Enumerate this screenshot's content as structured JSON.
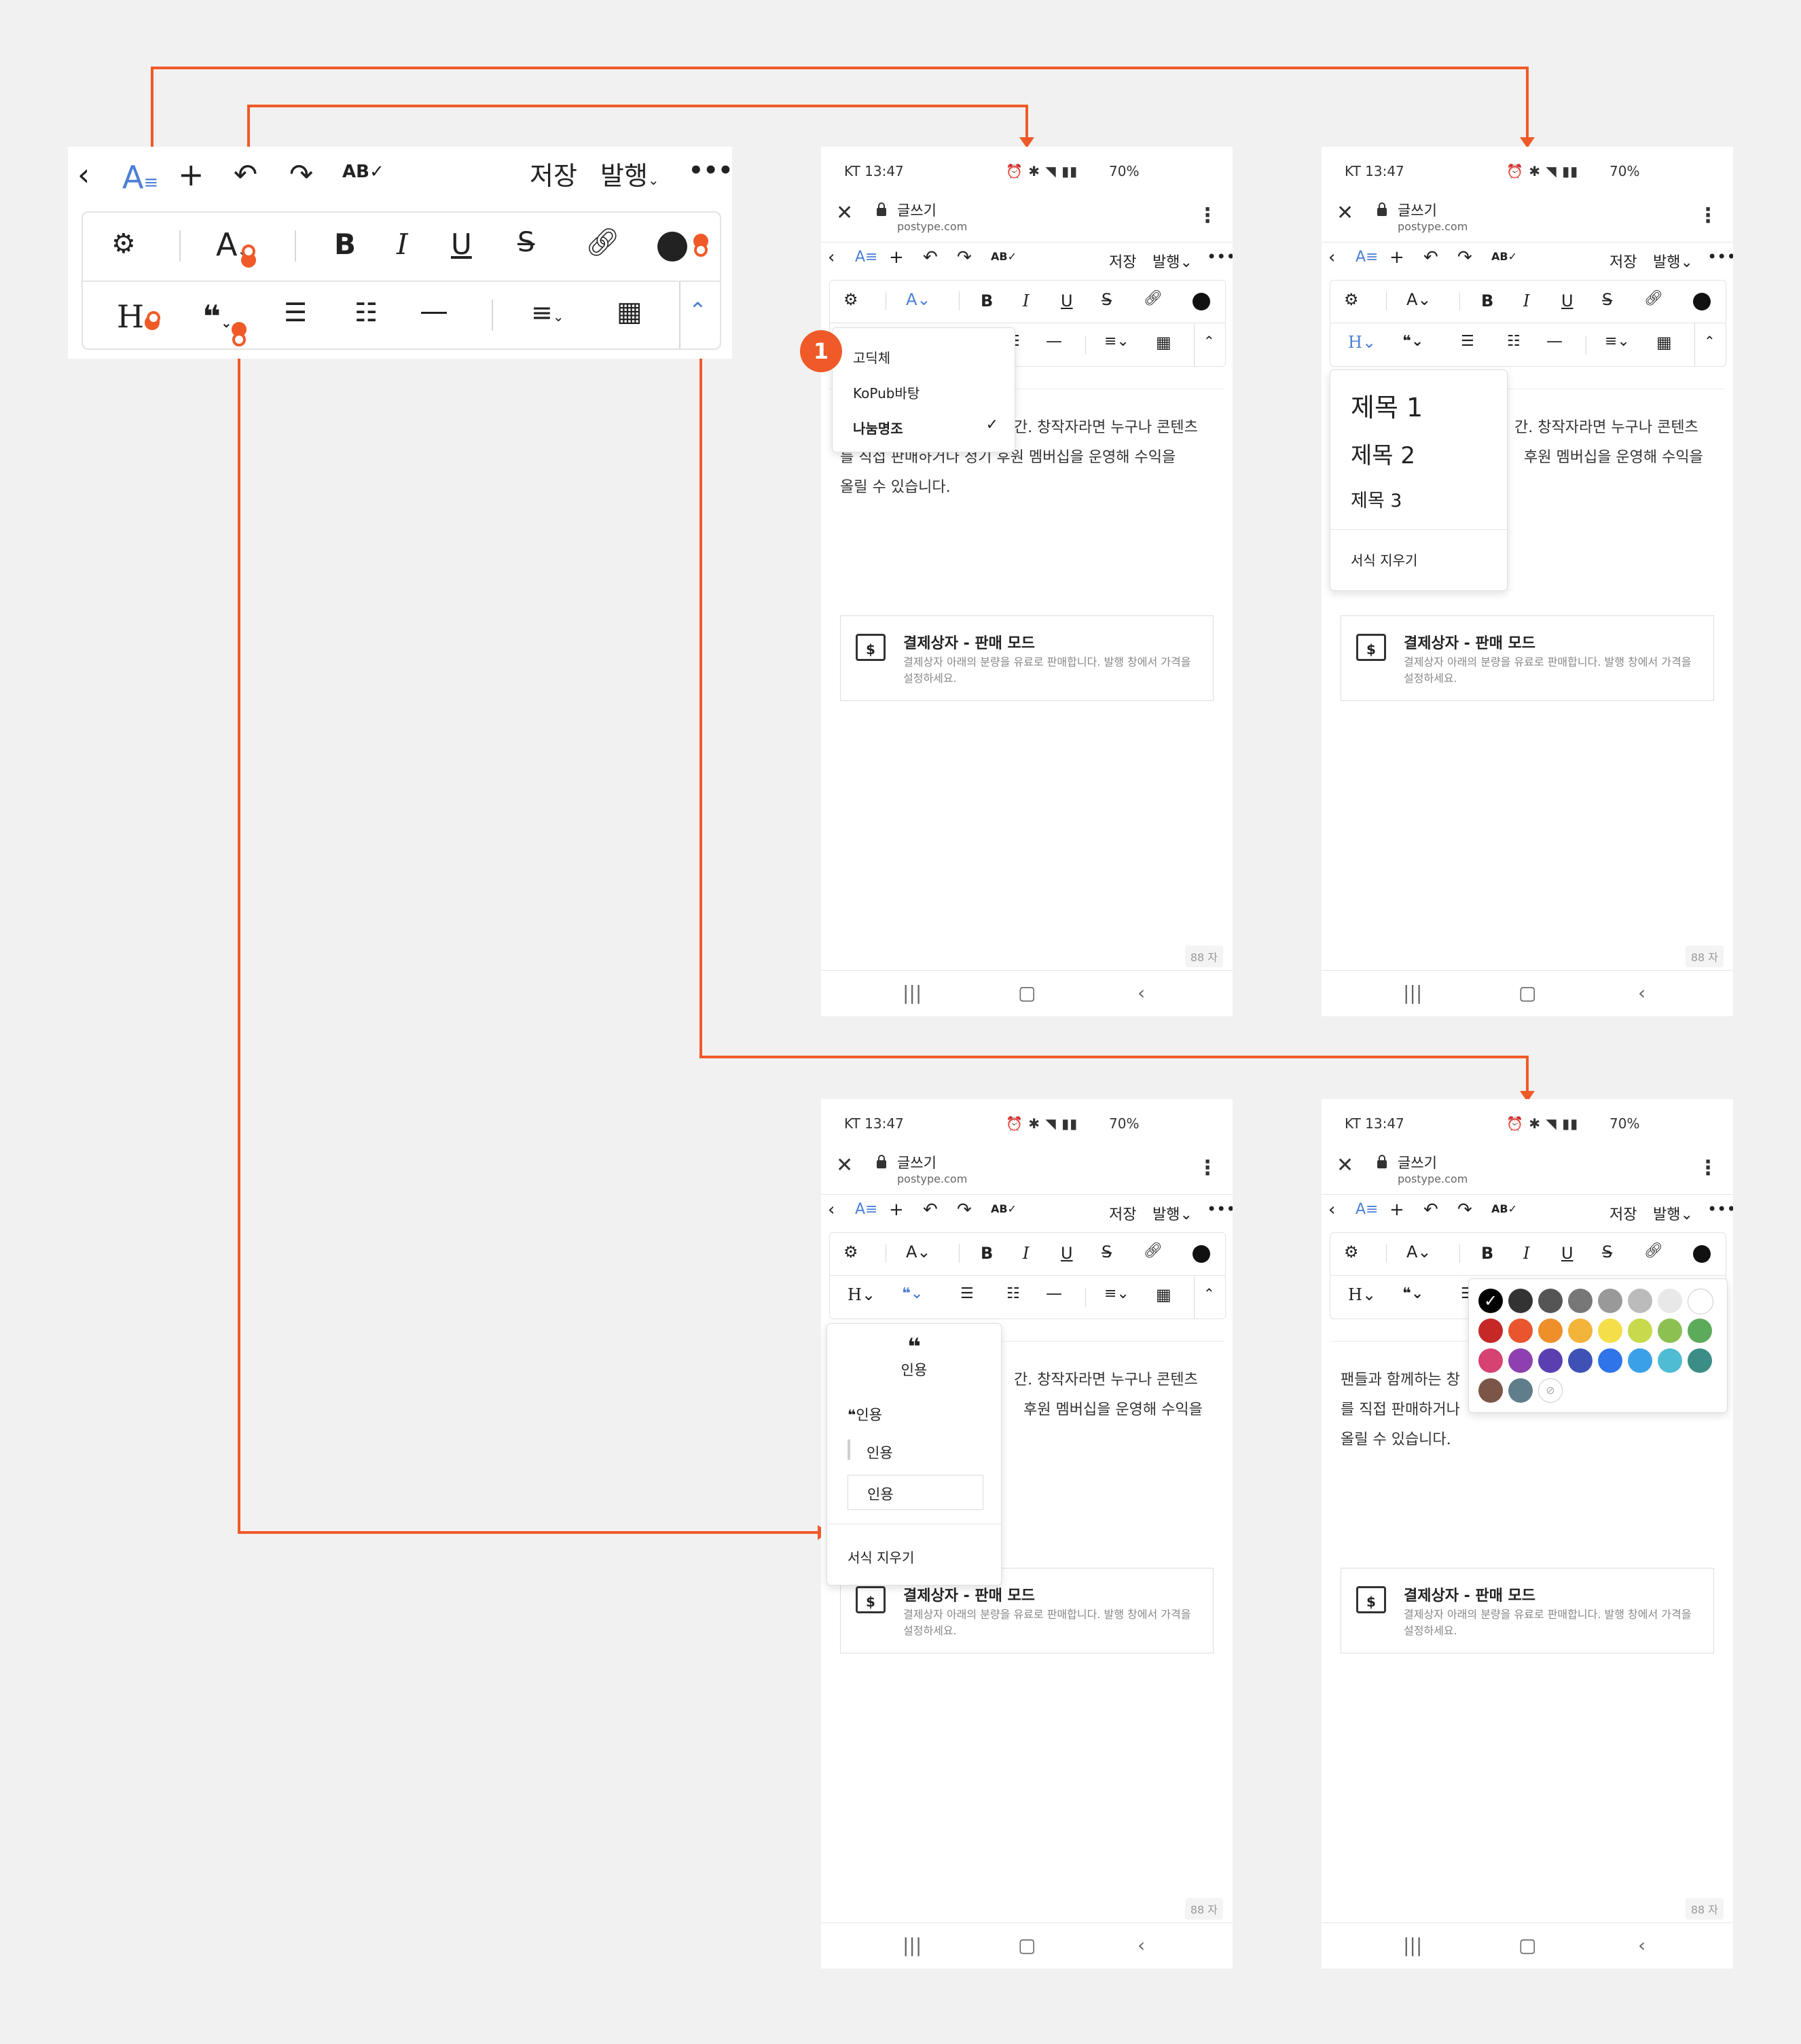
{
  "colors": {
    "accent": "#ef5a28",
    "blue": "#4c7fd6"
  },
  "toolbar": {
    "back_icon": "chevron-left-icon",
    "save_label": "저장",
    "publish_label": "발행",
    "more_label": "•••",
    "spellcheck_label": "AB",
    "bold_label": "B",
    "italic_label": "I",
    "underline_label": "U",
    "font_label": "A",
    "heading_label": "H"
  },
  "phone": {
    "status_carrier_time": "KT 13:47",
    "status_battery": "70%",
    "page_title": "글쓰기",
    "domain": "postype.com",
    "body_text_a": "간. 창작자라면 누구나 콘텐츠",
    "body_text_b": "를 직접 판매하거나 정기 후원 멤버십을 운영해 수익을",
    "body_text_c": "올릴 수 있습니다.",
    "body_text_d": "후원 멤버십을 운영해 수익을",
    "body_text_e": "팬들과 함께하는 창",
    "body_text_f": "를 직접 판매하거나",
    "body_text_g": "올릴 수 있습니다.",
    "card_title": "결제상자 - 판매 모드",
    "card_desc": "결제상자 아래의 분량을 유료로 판매합니다. 발행 창에서 가격을 설정하세요.",
    "card_icon_glyph": "$",
    "char_count": "88 자"
  },
  "font_menu": {
    "badge": "1",
    "items": [
      "고딕체",
      "KoPub바탕",
      "나눔명조"
    ],
    "selected": "나눔명조"
  },
  "heading_menu": {
    "items": [
      "제목 1",
      "제목 2",
      "제목 3"
    ],
    "clear": "서식 지우기"
  },
  "quote_menu": {
    "header_label": "인용",
    "items": [
      "인용",
      "인용",
      "인용"
    ],
    "clear": "서식 지우기"
  },
  "color_palette": {
    "rows": [
      [
        "#000000",
        "#333333",
        "#555555",
        "#777777",
        "#999999",
        "#bbbbbb",
        "#e8e8e8",
        "#ffffff"
      ],
      [
        "#c62828",
        "#e8552f",
        "#ef8f2a",
        "#f3b43a",
        "#f4df4a",
        "#c8d94b",
        "#8cc152",
        "#5cab5a"
      ],
      [
        "#d64272",
        "#8e3fb0",
        "#5a3fb0",
        "#3f51b5",
        "#2f74e8",
        "#3aa0e8",
        "#4fbcd4",
        "#3a8e86"
      ],
      [
        "#7b5548",
        "#607d8b",
        "none"
      ]
    ],
    "selected": "#000000"
  }
}
